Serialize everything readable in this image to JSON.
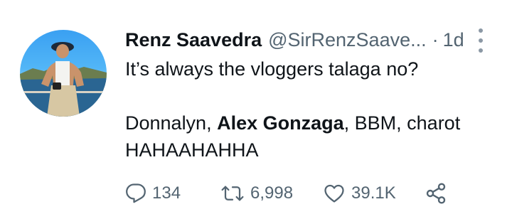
{
  "tweet": {
    "display_name": "Renz Saavedra",
    "handle": "@SirRenzSaave...",
    "separator": "·",
    "time": "1d",
    "text_line1": "It’s always the vloggers talaga no?",
    "text_line2_before": "Donnalyn, ",
    "text_line2_bold": "Alex Gonzaga",
    "text_line2_after": ", BBM, charot",
    "text_line3": "HAHAAHAHHA"
  },
  "actions": {
    "reply_count": "134",
    "retweet_count": "6,998",
    "like_count": "39.1K"
  },
  "icons": {
    "more": "more-vertical-icon",
    "reply": "reply-icon",
    "retweet": "retweet-icon",
    "like": "heart-icon",
    "share": "share-icon"
  },
  "colors": {
    "text": "#0f1419",
    "secondary": "#536471",
    "background": "#ffffff"
  }
}
